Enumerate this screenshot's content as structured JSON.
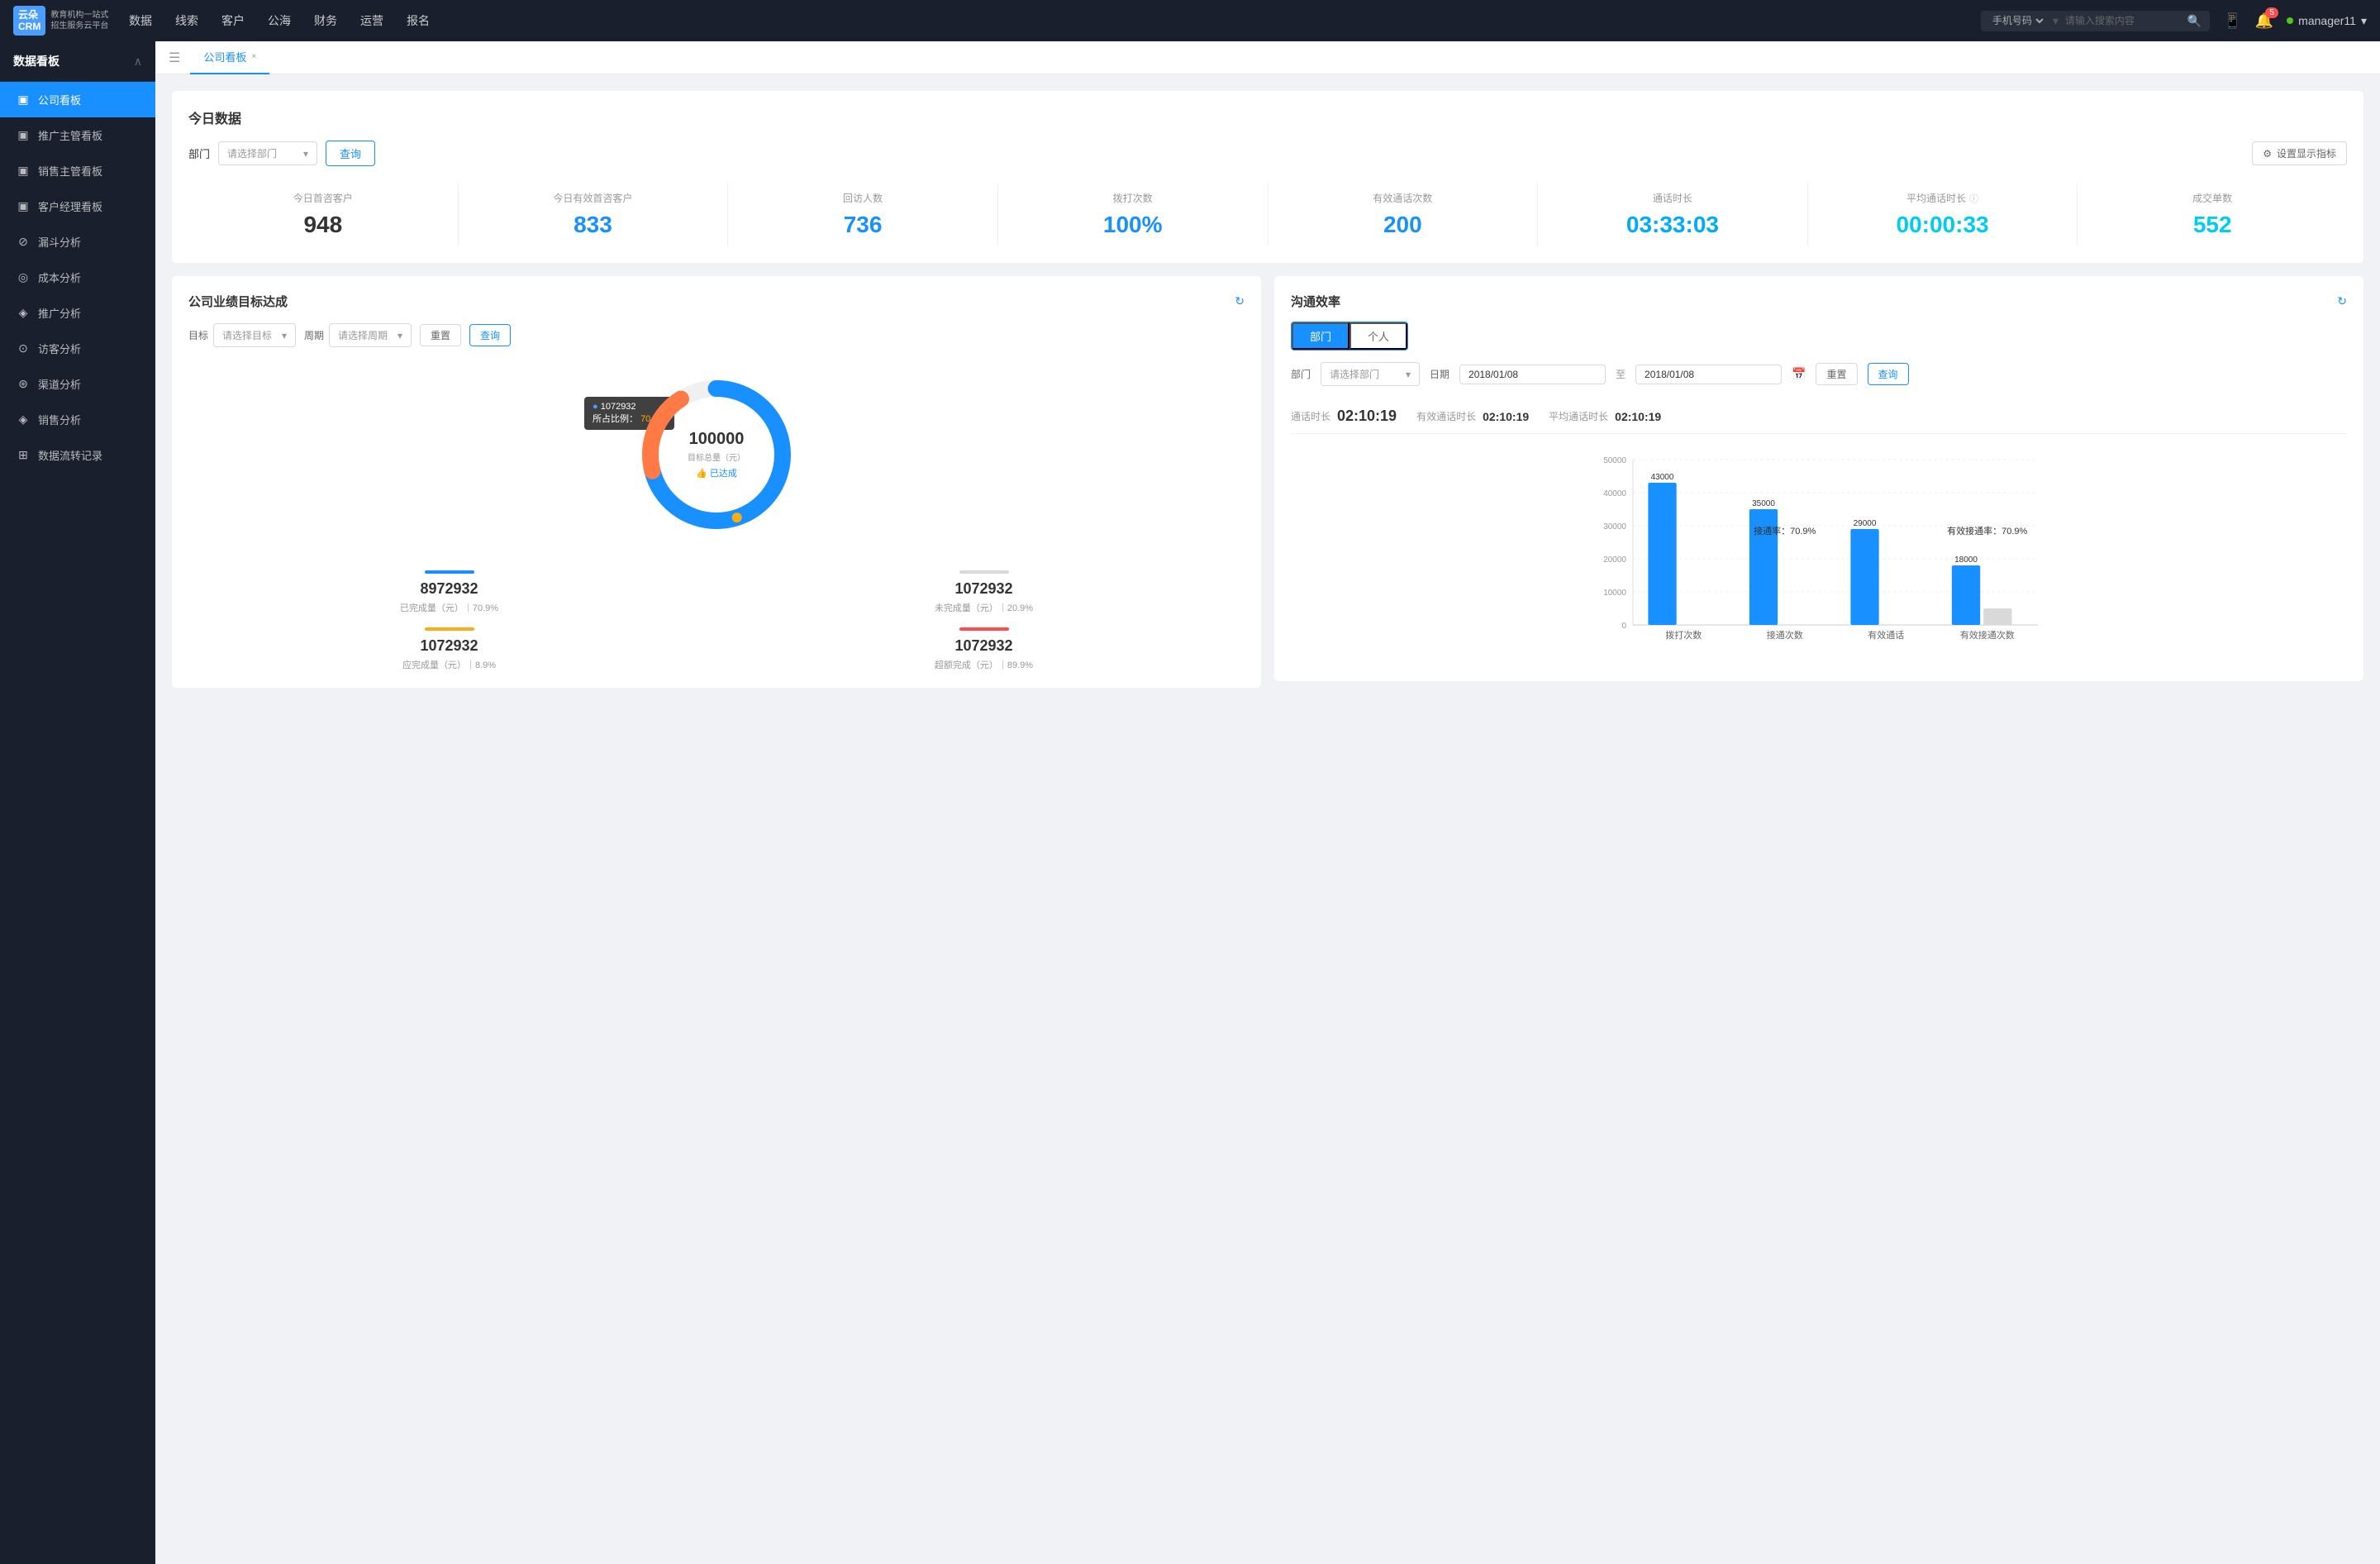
{
  "topNav": {
    "logo": {
      "name": "云朵CRM",
      "sub": "教育机构一站式\n招生服务云平台"
    },
    "navItems": [
      "数据",
      "线索",
      "客户",
      "公海",
      "财务",
      "运营",
      "报名"
    ],
    "search": {
      "placeholder": "请输入搜索内容",
      "select": "手机号码"
    },
    "notificationCount": "5",
    "username": "manager11"
  },
  "sidebar": {
    "title": "数据看板",
    "items": [
      {
        "label": "公司看板",
        "icon": "▣",
        "active": true
      },
      {
        "label": "推广主管看板",
        "icon": "▣"
      },
      {
        "label": "销售主管看板",
        "icon": "▣"
      },
      {
        "label": "客户经理看板",
        "icon": "▣"
      },
      {
        "label": "漏斗分析",
        "icon": "⊘"
      },
      {
        "label": "成本分析",
        "icon": "◎"
      },
      {
        "label": "推广分析",
        "icon": "◈"
      },
      {
        "label": "访客分析",
        "icon": "⊙"
      },
      {
        "label": "渠道分析",
        "icon": "⊛"
      },
      {
        "label": "销售分析",
        "icon": "◈"
      },
      {
        "label": "数据流转记录",
        "icon": "⊞"
      }
    ]
  },
  "tab": {
    "label": "公司看板",
    "close": "×"
  },
  "todayData": {
    "title": "今日数据",
    "filter": {
      "label": "部门",
      "placeholder": "请选择部门",
      "queryBtn": "查询",
      "settingsBtn": "设置显示指标"
    },
    "stats": [
      {
        "label": "今日首咨客户",
        "value": "948",
        "color": "black"
      },
      {
        "label": "今日有效首咨客户",
        "value": "833",
        "color": "blue-dark"
      },
      {
        "label": "回访人数",
        "value": "736",
        "color": "blue-dark"
      },
      {
        "label": "拨打次数",
        "value": "100%",
        "color": "blue-dark"
      },
      {
        "label": "有效通话次数",
        "value": "200",
        "color": "blue-dark"
      },
      {
        "label": "通话时长",
        "value": "03:33:03",
        "color": "blue-medium"
      },
      {
        "label": "平均通话时长",
        "value": "00:00:33",
        "color": "cyan"
      },
      {
        "label": "成交单数",
        "value": "552",
        "color": "cyan"
      }
    ]
  },
  "companyPerf": {
    "title": "公司业绩目标达成",
    "targetLabel": "目标",
    "targetPlaceholder": "请选择目标",
    "periodLabel": "周期",
    "periodPlaceholder": "请选择周期",
    "resetBtn": "重置",
    "queryBtn": "查询",
    "donut": {
      "value": "100000",
      "subtitle": "目标总量（元）",
      "achieved": "👍 已达成",
      "tooltip": {
        "label": "1072932",
        "pctLabel": "所占比例：",
        "pct": "70.9%"
      }
    },
    "stats": [
      {
        "label": "8972932",
        "sublabel": "已完成量（元）｜70.9%",
        "color": "#1890ff"
      },
      {
        "label": "1072932",
        "sublabel": "未完成量（元）｜20.9%",
        "color": "#d9d9d9"
      },
      {
        "label": "1072932",
        "sublabel": "应完成量（元）｜8.9%",
        "color": "#faad14"
      },
      {
        "label": "1072932",
        "sublabel": "超额完成（元）｜89.9%",
        "color": "#ff4d4f"
      }
    ]
  },
  "commEfficiency": {
    "title": "沟通效率",
    "tabs": [
      "部门",
      "个人"
    ],
    "activeTab": 0,
    "filterDept": {
      "label": "部门",
      "placeholder": "请选择部门"
    },
    "filterDate": {
      "label": "日期",
      "start": "2018/01/08",
      "end": "2018/01/08"
    },
    "resetBtn": "重置",
    "queryBtn": "查询",
    "stats": [
      {
        "label": "通话时长",
        "value": "02:10:19"
      },
      {
        "label": "有效通话时长",
        "value": "02:10:19"
      },
      {
        "label": "平均通话时长",
        "value": "02:10:19"
      }
    ],
    "chart": {
      "yLabels": [
        "50000",
        "40000",
        "30000",
        "20000",
        "10000",
        "0"
      ],
      "groups": [
        {
          "xLabel": "拨打次数",
          "bars": [
            {
              "value": 43000,
              "label": "43000",
              "color": "#1890ff"
            },
            {
              "value": 0,
              "label": "",
              "color": "#d9d9d9"
            }
          ],
          "rateLabel": "",
          "rateLabelText": ""
        },
        {
          "xLabel": "接通次数",
          "bars": [
            {
              "value": 35000,
              "label": "35000",
              "color": "#1890ff"
            },
            {
              "value": 0,
              "label": "",
              "color": "#d9d9d9"
            }
          ],
          "rateLabel": "接通率：70.9%",
          "rateLabelPos": "center"
        },
        {
          "xLabel": "有效通话",
          "bars": [
            {
              "value": 29000,
              "label": "29000",
              "color": "#1890ff"
            },
            {
              "value": 0,
              "label": "",
              "color": "#d9d9d9"
            }
          ],
          "rateLabel": "",
          "rateLabelText": ""
        },
        {
          "xLabel": "有效接通次数",
          "bars": [
            {
              "value": 18000,
              "label": "18000",
              "color": "#1890ff"
            },
            {
              "value": 5000,
              "label": "",
              "color": "#d9d9d9"
            }
          ],
          "rateLabel": "有效接通率：70.9%",
          "rateLabelPos": "right"
        }
      ]
    }
  }
}
